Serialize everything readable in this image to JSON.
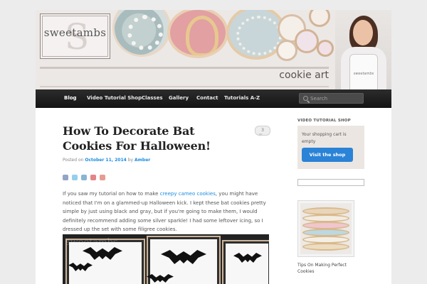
{
  "header": {
    "logo_text": "sweetambs",
    "logo_monogram": "S",
    "tagline": "cookie art",
    "apron_text": "sweetambs"
  },
  "nav": {
    "items": [
      {
        "label": "Blog",
        "active": true
      },
      {
        "label": "Video Tutorial Shop"
      },
      {
        "label": "Classes"
      },
      {
        "label": "Gallery"
      },
      {
        "label": "Contact"
      },
      {
        "label": "Tutorials A-Z"
      }
    ],
    "search_placeholder": "Search"
  },
  "post": {
    "title": "How To Decorate Bat Cookies For Halloween!",
    "comment_count": "3",
    "meta_prefix": "Posted on ",
    "date": "October 11, 2014",
    "meta_by": " by ",
    "author": "Amber",
    "share_icons": [
      "facebook-icon",
      "twitter-icon",
      "linkedin-icon",
      "pinterest-icon",
      "googleplus-icon"
    ],
    "body_before_link": "If you saw my tutorial on how to make ",
    "body_link": "creepy cameo cookies",
    "body_after_link": ", you might have noticed that I'm on a glammed-up Halloween kick. I kept these bat cookies pretty simple by just using black and gray, but if you're going to make them, I would definitely recommend adding some silver sparkle! I had some leftover icing, so I dressed up the set with some filigree cookies.",
    "image_watermark": "sweetambs"
  },
  "sidebar": {
    "heading": "VIDEO TUTORIAL SHOP",
    "cart_text": "Your shopping cart is empty",
    "visit_shop_label": "Visit the shop",
    "thumb_caption": "Tips On Making Perfect Cookies"
  },
  "colors": {
    "link": "#1b8be0",
    "button": "#2a83d6",
    "nav_bg": "#1e1e1e"
  }
}
